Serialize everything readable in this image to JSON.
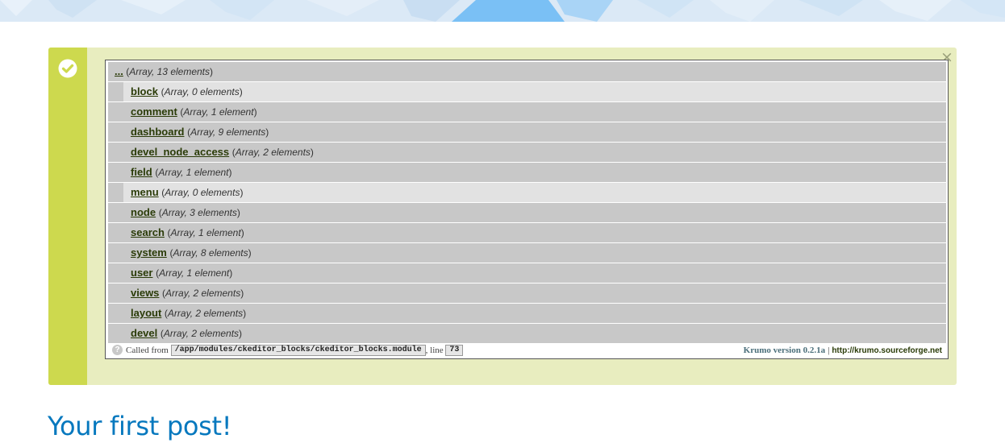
{
  "colors": {
    "banner_light": "#dbe9f6",
    "banner_accent": "#7ac0f5",
    "message_bg": "#e8edbf",
    "message_side": "#cdd94e",
    "row_dark": "#c8c8c8",
    "row_light": "#e2e2e2",
    "title_blue": "#0678be"
  },
  "message": {
    "status_icon": "checkmark-circle-icon",
    "close_label": "×"
  },
  "krumo": {
    "root": {
      "key": "...",
      "open": "(",
      "type": "Array, 13 elements",
      "close": ")"
    },
    "items": [
      {
        "key": "block",
        "type": "Array, 0 elements"
      },
      {
        "key": "comment",
        "type": "Array, 1 element"
      },
      {
        "key": "dashboard",
        "type": "Array, 9 elements"
      },
      {
        "key": "devel_node_access",
        "type": "Array, 2 elements"
      },
      {
        "key": "field",
        "type": "Array, 1 element"
      },
      {
        "key": "menu",
        "type": "Array, 0 elements"
      },
      {
        "key": "node",
        "type": "Array, 3 elements"
      },
      {
        "key": "search",
        "type": "Array, 1 element"
      },
      {
        "key": "system",
        "type": "Array, 8 elements"
      },
      {
        "key": "user",
        "type": "Array, 1 element"
      },
      {
        "key": "views",
        "type": "Array, 2 elements"
      },
      {
        "key": "layout",
        "type": "Array, 2 elements"
      },
      {
        "key": "devel",
        "type": "Array, 2 elements"
      }
    ],
    "footer": {
      "help_glyph": "?",
      "called_from": "Called from",
      "file_path": "/app/modules/ckeditor_blocks/ckeditor_blocks.module",
      "line_label": ", line",
      "line_number": "73",
      "version": "Krumo version 0.2.1a",
      "separator": "|",
      "url": "http://krumo.sourceforge.net"
    }
  },
  "post": {
    "title": "Your first post!"
  }
}
